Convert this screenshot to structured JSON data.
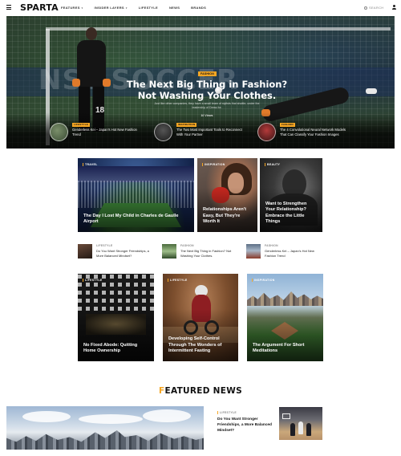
{
  "nav": {
    "logo": "SPARTA",
    "menu": [
      {
        "label": "FEATURES",
        "has_caret": true
      },
      {
        "label": "INSIDER LAYERS",
        "has_caret": true
      },
      {
        "label": "LIFESTYLE",
        "has_caret": false
      },
      {
        "label": "NEWS",
        "has_caret": false
      },
      {
        "label": "BRANDS",
        "has_caret": false
      }
    ],
    "search_placeholder": "SEARCH",
    "icons": {
      "menu": "hamburger-icon",
      "search": "search-icon",
      "user": "user-icon"
    }
  },
  "hero": {
    "category": "FASHION",
    "title": "The Next Big Thing in Fashion? Not Washing Your Clothes.",
    "excerpt": "Just like other companies, they have a small team of stylists that shuttle, under the leadership of Dress for.",
    "meta": "10 Views",
    "background_text": "NSL SOCCER",
    "jersey_number": "18",
    "small_posts": [
      {
        "category": "LIFESTYLE",
        "title": "Genderless Kei – Japan's Hot New Fashion Trend"
      },
      {
        "category": "INSPIRATION",
        "title": "The Two Most Important Tools to Reconnect With Your Partner"
      },
      {
        "category": "FASHION",
        "title": "The 4 Convolutional Neural Network Models That Can Classify Your Fashion Images"
      }
    ]
  },
  "cards_row1": [
    {
      "category": "TRAVEL",
      "title": "The Day I Lost My Child in Charles de Gaulle Airport"
    },
    {
      "category": "INSPIRATION",
      "title": "Relationships Aren't Easy, But They're Worth It"
    },
    {
      "category": "BEAUTY",
      "title": "Want to Strengthen Your Relationship? Embrace the Little Things"
    }
  ],
  "mini_list": [
    {
      "category": "LIFESTYLE",
      "title": "Do You Want Stronger Friendships, a More Balanced Mindset?"
    },
    {
      "category": "FASHION",
      "title": "The Next Big Thing in Fashion? Not Washing Your Clothes."
    },
    {
      "category": "FASHION",
      "title": "Genderless Kei – Japan's Hot New Fashion Trend"
    }
  ],
  "cards_row2": [
    {
      "category": "LIFESTYLE",
      "title": "No Fixed Abode: Quitting Home Ownership"
    },
    {
      "category": "LIFESTYLE",
      "title": "Developing Self-Control Through The Wonders of Intermittent Fasting"
    },
    {
      "category": "INSPIRATION",
      "title": "The Argument For Short Meditations"
    }
  ],
  "featured": {
    "heading_first": "F",
    "heading_rest": "EATURED NEWS",
    "side_post": {
      "category": "LIFESTYLE",
      "title": "Do You Want Stronger Friendships, a More Balanced Mindset?"
    }
  },
  "colors": {
    "accent": "#f5a623",
    "text": "#111111",
    "muted": "#888888"
  }
}
